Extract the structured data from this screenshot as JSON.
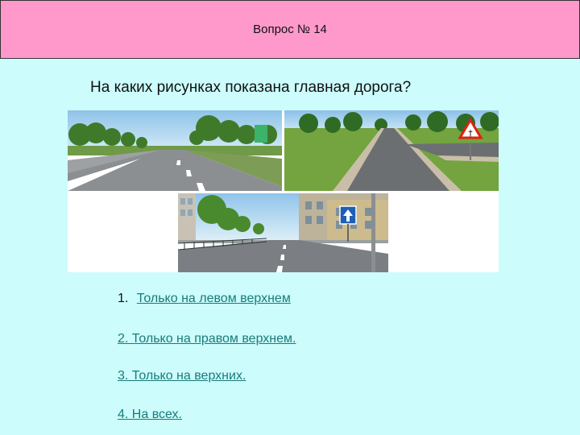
{
  "header": {
    "title": "Вопрос № 14"
  },
  "question": {
    "text": "На каких рисунках показана главная дорога?"
  },
  "figure": {
    "images": [
      {
        "name": "Road scene top-left"
      },
      {
        "name": "Road scene top-right"
      },
      {
        "name": "Road scene bottom"
      }
    ]
  },
  "answers": [
    {
      "number": "1.",
      "text": "Только на левом верхнем"
    },
    {
      "number": "",
      "text": "2. Только на правом верхнем."
    },
    {
      "number": "",
      "text": "3. Только на верхних."
    },
    {
      "number": "",
      "text": "4. На всех."
    }
  ],
  "colors": {
    "background": "#ccfcfc",
    "header": "#ff99cc",
    "link": "#1a7b7b"
  }
}
